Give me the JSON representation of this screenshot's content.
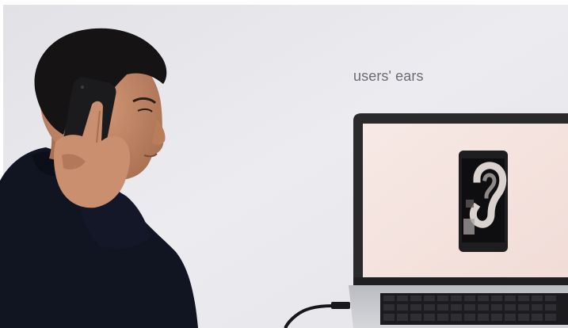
{
  "scene": {
    "caption": "users' ears",
    "colors": {
      "wall": "#e6e6eb",
      "shirt": "#111522",
      "skin": "#c98f6e",
      "hair": "#151313",
      "phone": "#1b1b1d",
      "laptop_frame": "#2a2a2d",
      "laptop_screen": "#f4e3df",
      "laptop_body": "#c9cace",
      "keyboard": "#1c1c1f"
    },
    "icons": {
      "ear": "ear-icon"
    }
  }
}
